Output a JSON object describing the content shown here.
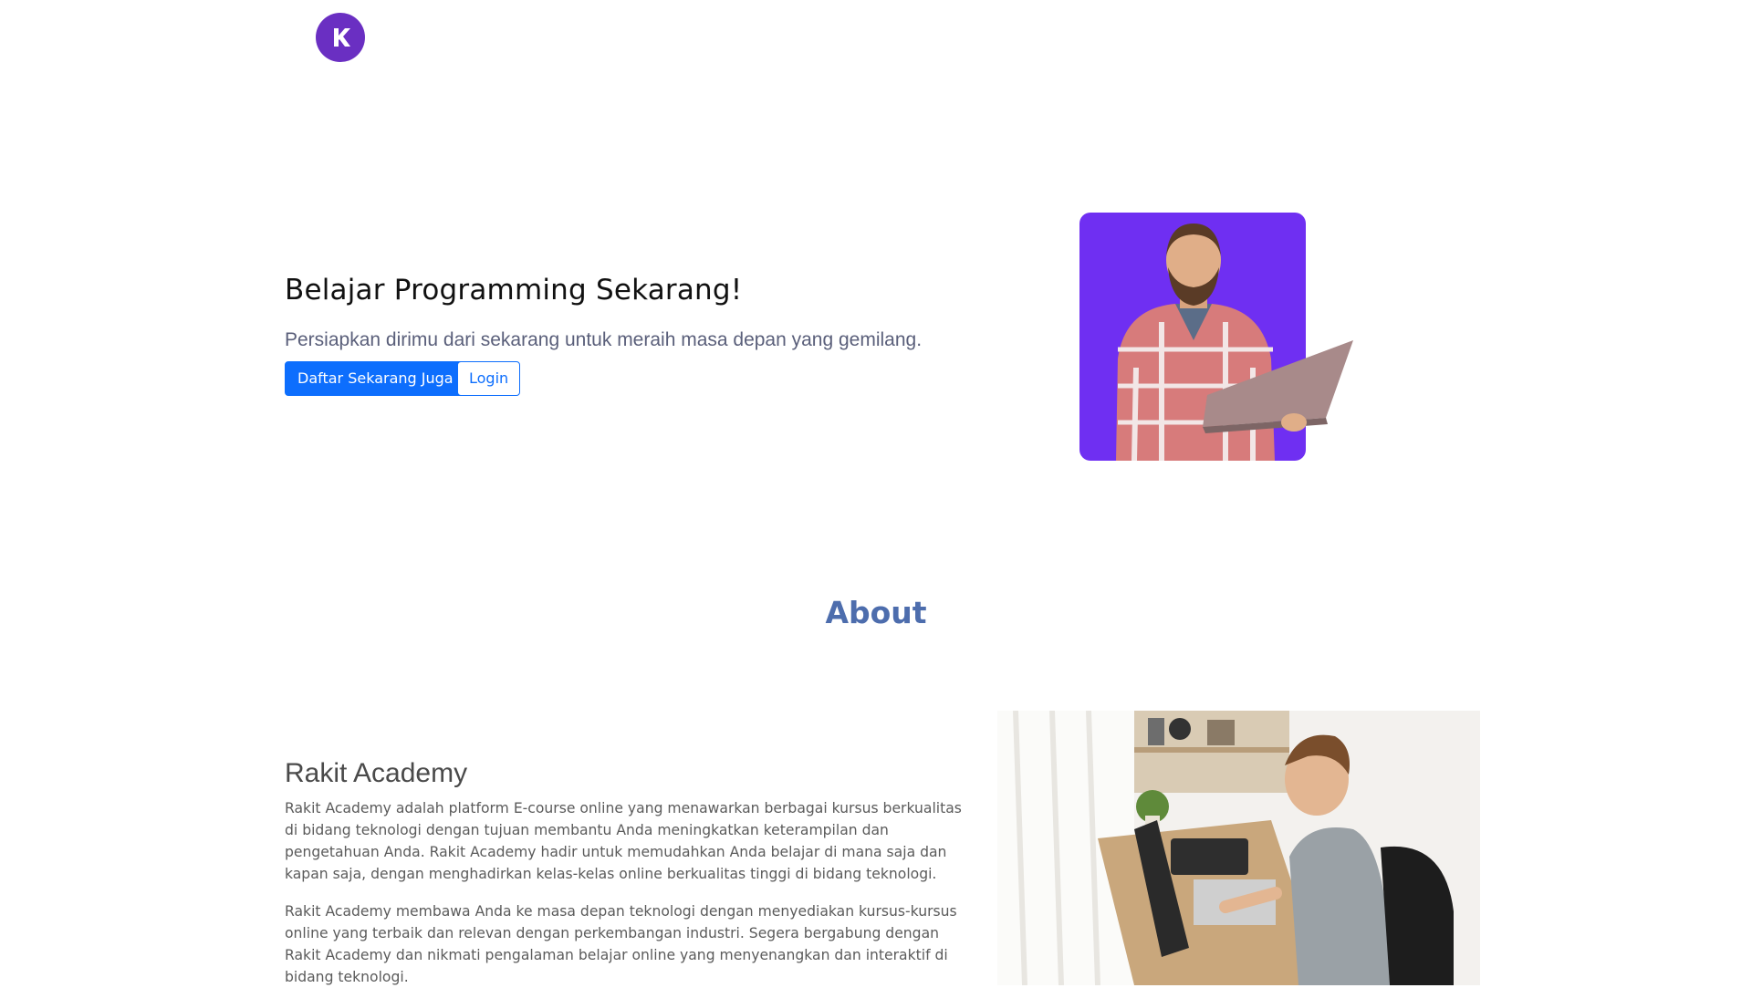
{
  "brand": {
    "logo_letter": "K",
    "logo_color": "#6a2fc2"
  },
  "hero": {
    "title": "Belajar Programming Sekarang!",
    "subtitle": "Persiapkan dirimu dari sekarang untuk meraih masa depan yang gemilang.",
    "primary_button": "Daftar Sekarang Juga",
    "secondary_button": "Login",
    "image_bg_color": "#6f2ff2"
  },
  "about": {
    "section_title": "About",
    "heading": "Rakit Academy",
    "paragraph_1": "Rakit Academy adalah platform E-course online yang menawarkan berbagai kursus berkualitas di bidang teknologi dengan tujuan membantu Anda meningkatkan keterampilan dan pengetahuan Anda. Rakit Academy hadir untuk memudahkan Anda belajar di mana saja dan kapan saja, dengan menghadirkan kelas-kelas online berkualitas tinggi di bidang teknologi.",
    "paragraph_2": "Rakit Academy membawa Anda ke masa depan teknologi dengan menyediakan kursus-kursus online yang terbaik dan relevan dengan perkembangan industri. Segera bergabung dengan Rakit Academy dan nikmati pengalaman belajar online yang menyenangkan dan interaktif di bidang teknologi."
  },
  "colors": {
    "accent": "#0d6efd",
    "about_title": "#4d6dad"
  }
}
